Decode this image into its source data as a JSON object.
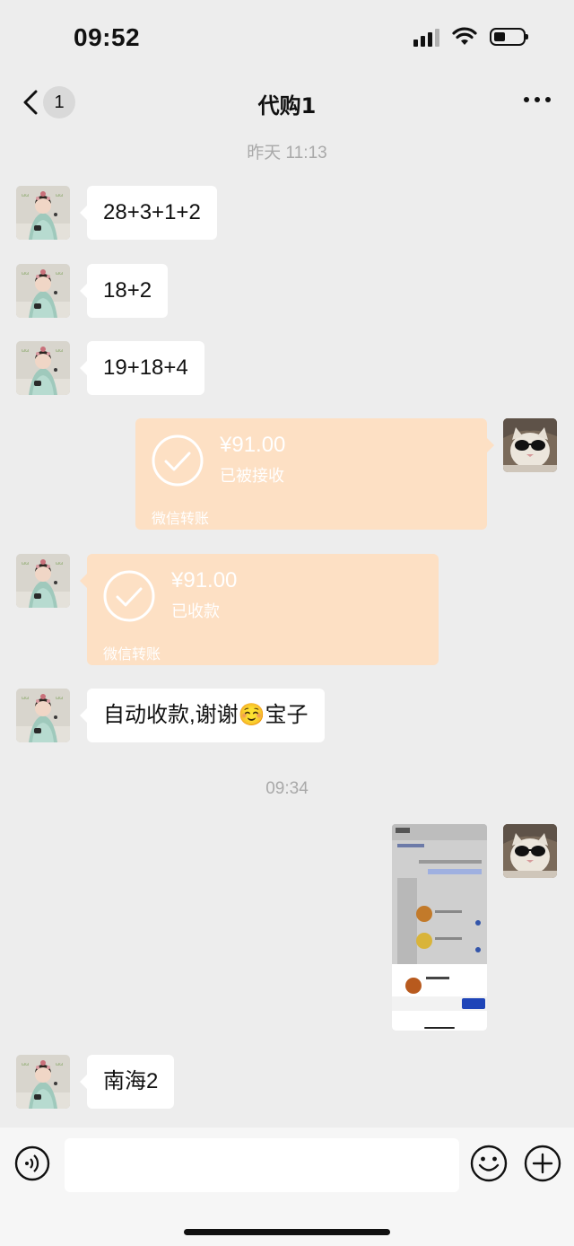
{
  "status_bar": {
    "time": "09:52",
    "battery_level": 0.35
  },
  "nav": {
    "back_badge": "1",
    "title": "代购1"
  },
  "timestamps": [
    "昨天 11:13",
    "09:34"
  ],
  "messages": {
    "m1": "28+3+1+2",
    "m2": "18+2",
    "m3": "19+18+4",
    "m4": {
      "amount": "¥91.00",
      "status": "已被接收",
      "footer": "微信转账"
    },
    "m5": {
      "amount": "¥91.00",
      "status": "已收款",
      "footer": "微信转账"
    },
    "m6": "自动收款,谢谢☺️宝子",
    "m7_image": "screenshot-thumbnail",
    "m8": "南海2"
  },
  "input": {
    "placeholder": ""
  },
  "icons": [
    "back-chevron-icon",
    "more-icon",
    "voice-icon",
    "emoji-icon",
    "plus-icon",
    "checkmark-icon"
  ],
  "colors": {
    "transfer_bg": "#fde0c4",
    "bubble_bg": "#ffffff",
    "chat_bg": "#ededed"
  }
}
